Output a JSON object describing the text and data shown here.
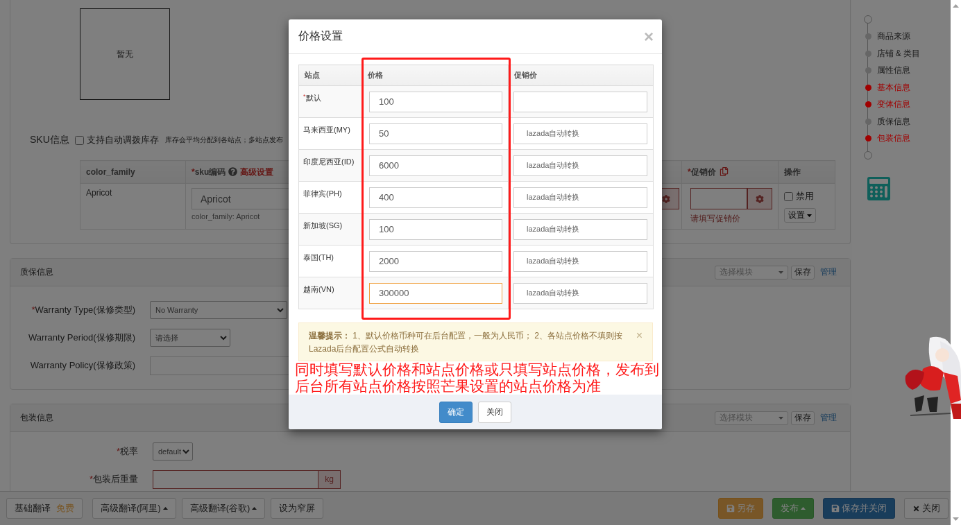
{
  "image_box": {
    "text": "暂无"
  },
  "sku": {
    "label": "SKU信息",
    "auto_stock": {
      "label": "支持自动调拨库存",
      "checked": false
    },
    "note": "库存会平均分配到各站点；多站点发布",
    "columns": [
      {
        "kind": "plain",
        "label": "color_family"
      },
      {
        "kind": "sku",
        "asterisk": "*",
        "label": "sku编码",
        "link": "高级设置"
      },
      {
        "kind": "hidden"
      },
      {
        "kind": "promo",
        "asterisk": "*",
        "label": "促销价"
      },
      {
        "kind": "plain",
        "label": "操作"
      }
    ],
    "row": {
      "color_family": "Apricot",
      "sku_value": "Apricot",
      "sku_hint": "color_family: Apricot",
      "promo_error": "请填写促销价",
      "disable": {
        "label": "禁用",
        "checked": false
      },
      "settings": "设置"
    }
  },
  "sections": [
    {
      "title": "质保信息",
      "module_select": "选择模块",
      "save": "保存",
      "manage": "管理",
      "fields": [
        {
          "asterisk": "*",
          "label": "Warranty Type(保修类型)",
          "kind": "select",
          "value": "No Warranty",
          "error": false
        },
        {
          "label": "Warranty Period(保修期限)",
          "kind": "select",
          "value": "请选择",
          "error": false
        },
        {
          "label": "Warranty Policy(保修政策)",
          "kind": "input",
          "error": false
        }
      ]
    },
    {
      "title": "包装信息",
      "module_select": "选择模块",
      "save": "保存",
      "manage": "管理",
      "fields": [
        {
          "asterisk": "*",
          "label": "税率",
          "kind": "select",
          "value": "default",
          "error": false
        },
        {
          "asterisk": "*",
          "label": "包装后重量",
          "kind": "input",
          "addon": "kg",
          "error": true
        }
      ]
    }
  ],
  "nav": [
    {
      "label": "商品来源",
      "color": "#666666"
    },
    {
      "label": "店铺 & 类目",
      "color": "#666666"
    },
    {
      "label": "属性信息",
      "color": "#666666"
    },
    {
      "label": "基本信息",
      "color": "#a00000"
    },
    {
      "label": "变体信息",
      "color": "#a00000"
    },
    {
      "label": "质保信息",
      "color": "#666666"
    },
    {
      "label": "包装信息",
      "color": "#a00000"
    }
  ],
  "toolbar": {
    "left": [
      {
        "label": "基础翻译",
        "badge": "免费",
        "caret": false
      },
      {
        "label": "高级翻译(阿里)",
        "caret": true
      },
      {
        "label": "高级翻译(谷歌)",
        "caret": true
      },
      {
        "label": "设为窄屏",
        "caret": false
      }
    ],
    "right": [
      {
        "label": "另存",
        "kind": "warning",
        "caret": false
      },
      {
        "label": "发布",
        "kind": "success",
        "caret": true
      },
      {
        "label": "保存并关闭",
        "kind": "primary",
        "caret": false
      },
      {
        "label": "关闭",
        "kind": "default",
        "caret": false
      }
    ]
  },
  "modal": {
    "title": "价格设置",
    "close": "×",
    "columns": [
      "站点",
      "价格",
      "促销价"
    ],
    "rows": [
      {
        "site": "默认",
        "asterisk": "*",
        "price": "100",
        "focused": false
      },
      {
        "site": "马来西亚(MY)",
        "price": "50",
        "promo_placeholder": "lazada自动转换",
        "focused": false
      },
      {
        "site": "印度尼西亚(ID)",
        "price": "6000",
        "promo_placeholder": "lazada自动转换",
        "focused": false
      },
      {
        "site": "菲律宾(PH)",
        "price": "400",
        "promo_placeholder": "lazada自动转换",
        "focused": false
      },
      {
        "site": "新加坡(SG)",
        "price": "100",
        "promo_placeholder": "lazada自动转换",
        "focused": false
      },
      {
        "site": "泰国(TH)",
        "price": "2000",
        "promo_placeholder": "lazada自动转换",
        "focused": false
      },
      {
        "site": "越南(VN)",
        "price": "300000",
        "promo_placeholder": "lazada自动转换",
        "focused": true
      }
    ],
    "alert": {
      "text": "**温馨提示：** 1、默认价格币种可在后台配置，一般为人民币； 2、各站点价格不填则按Lazada后台配置公式自动转换",
      "close": "×"
    },
    "annotation": "同时填写默认价格和站点价格或只填写站点价格，发布到后台所有站点价格按照芒果设置的站点价格为准",
    "buttons": [
      {
        "label": "确定",
        "kind": "primary"
      },
      {
        "label": "关闭",
        "kind": "default"
      }
    ]
  }
}
